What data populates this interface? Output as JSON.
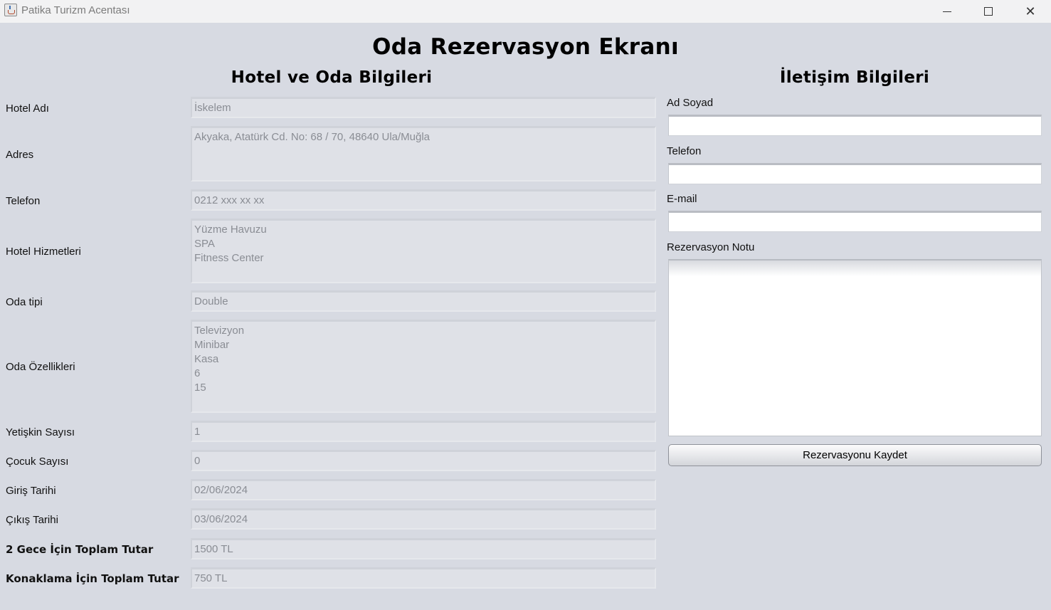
{
  "window": {
    "title": "Patika Turizm Acentası",
    "minimize_icon": "minimize-icon",
    "maximize_icon": "maximize-icon",
    "close_icon": "close-icon",
    "close_glyph": "✕"
  },
  "header": {
    "title": "Oda Rezervasyon Ekranı"
  },
  "hotel_section": {
    "title": "Hotel ve Oda Bilgileri",
    "fields": {
      "hotel_name": {
        "label": "Hotel Adı",
        "value": "İskelem"
      },
      "address": {
        "label": "Adres",
        "value": "Akyaka, Atatürk Cd. No: 68 / 70, 48640 Ula/Muğla"
      },
      "phone": {
        "label": "Telefon",
        "value": "0212 xxx xx xx"
      },
      "services": {
        "label": "Hotel Hizmetleri",
        "value": "Yüzme Havuzu\nSPA\nFitness Center"
      },
      "room_type": {
        "label": "Oda tipi",
        "value": "Double"
      },
      "room_features": {
        "label": "Oda Özellikleri",
        "value": "Televizyon\nMinibar\nKasa\n6\n15"
      },
      "adult_count": {
        "label": "Yetişkin Sayısı",
        "value": "1"
      },
      "child_count": {
        "label": "Çocuk Sayısı",
        "value": "0"
      },
      "checkin_date": {
        "label": "Giriş Tarihi",
        "value": "02/06/2024"
      },
      "checkout_date": {
        "label": "Çıkış Tarihi",
        "value": "03/06/2024"
      },
      "nightly_total": {
        "label": "2 Gece İçin Toplam Tutar",
        "value": "1500 TL"
      },
      "stay_total": {
        "label": "Konaklama İçin Toplam Tutar",
        "value": "750 TL"
      }
    }
  },
  "contact_section": {
    "title": "İletişim Bilgileri",
    "name_label": "Ad Soyad",
    "name_value": "",
    "phone_label": "Telefon",
    "phone_value": "",
    "email_label": "E-mail",
    "email_value": "",
    "note_label": "Rezervasyon Notu",
    "note_value": "",
    "save_button": "Rezervasyonu Kaydet"
  },
  "colors": {
    "background": "#d7dae2",
    "titlebar": "#f2f2f3",
    "readonly_text": "#8a8d94"
  }
}
